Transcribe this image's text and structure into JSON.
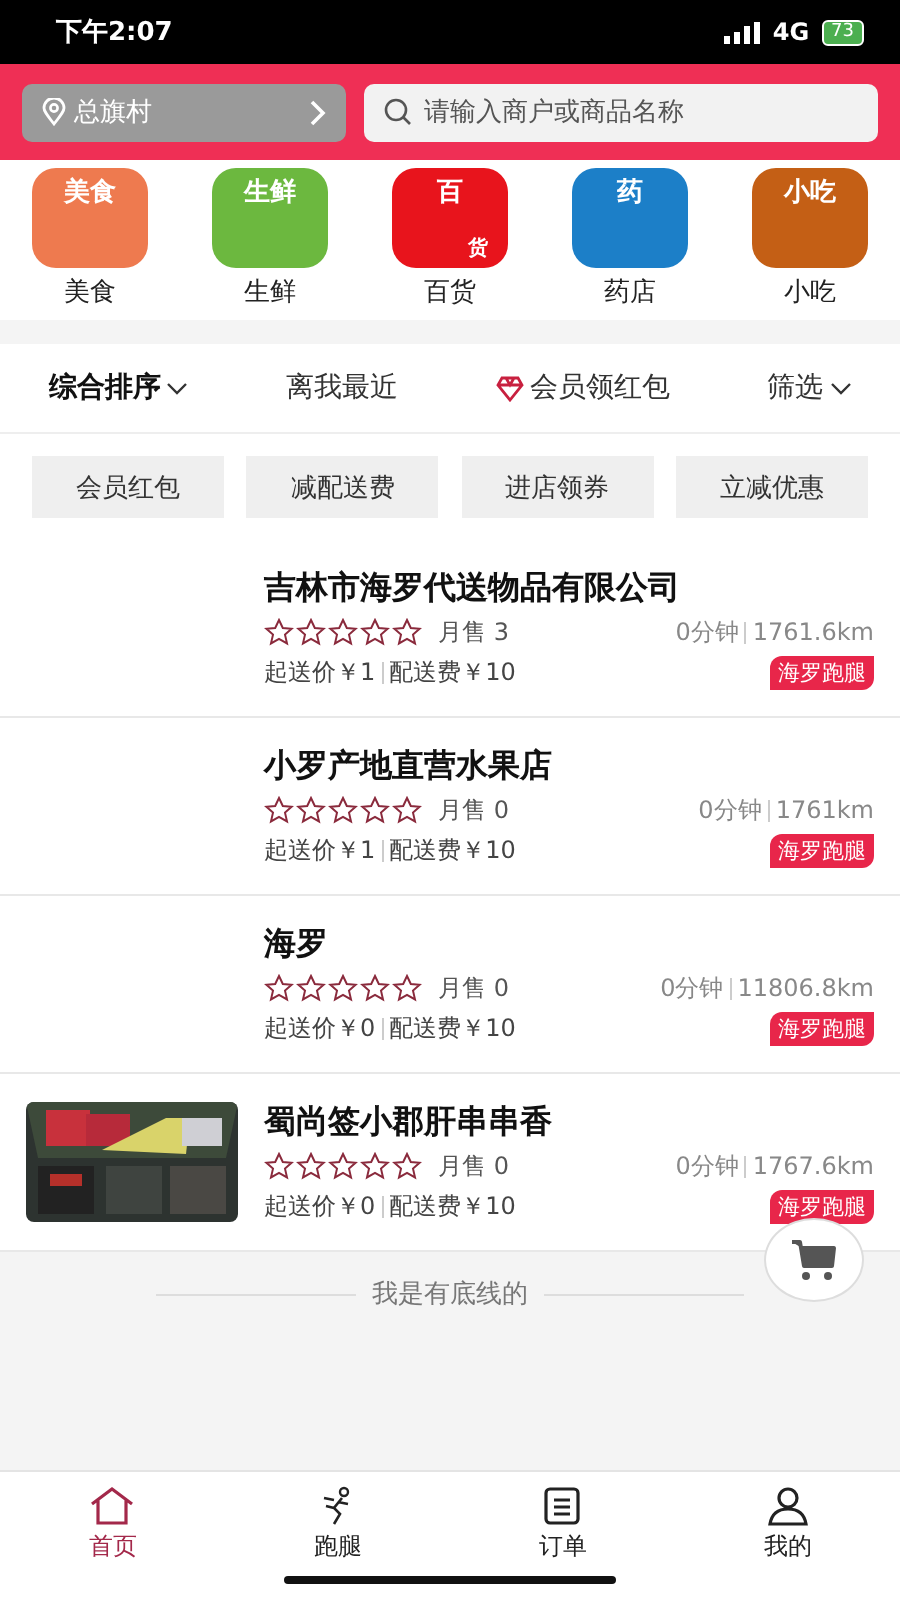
{
  "status_bar": {
    "time": "下午2:07",
    "network": "4G",
    "battery": "73"
  },
  "header": {
    "location": "总旗村",
    "search": {
      "placeholder": "请输入商户或商品名称"
    }
  },
  "categories": [
    {
      "label": "美食",
      "icon_text": [
        "美食"
      ],
      "color": "#ee7a4f"
    },
    {
      "label": "生鲜",
      "icon_text": [
        "生鲜"
      ],
      "color": "#6cb83f"
    },
    {
      "label": "百货",
      "icon_text": [
        "百",
        "货"
      ],
      "color": "#e8141c"
    },
    {
      "label": "药店",
      "icon_text": [
        "药"
      ],
      "color": "#1c7fc8"
    },
    {
      "label": "小吃",
      "icon_text": [
        "小吃"
      ],
      "color": "#c45f15"
    }
  ],
  "sort_options": [
    {
      "label": "综合排序",
      "selected": true,
      "kind": "dropdown"
    },
    {
      "label": "离我最近",
      "selected": false,
      "kind": "plain"
    },
    {
      "label": "会员领红包",
      "selected": false,
      "kind": "gem"
    },
    {
      "label": "筛选",
      "selected": false,
      "kind": "dropdown"
    }
  ],
  "filter_chips": [
    "会员红包",
    "减配送费",
    "进店领券",
    "立减优惠"
  ],
  "shops": [
    {
      "name": "吉林市海罗代送物品有限公司",
      "stars": 0,
      "monthly_sales": "月售 3",
      "time": "0分钟",
      "distance": "1761.6km",
      "min_order": "起送价￥1",
      "delivery_fee": "配送费￥10",
      "tag": "海罗跑腿"
    },
    {
      "name": "小罗产地直营水果店",
      "stars": 0,
      "monthly_sales": "月售 0",
      "time": "0分钟",
      "distance": "1761km",
      "min_order": "起送价￥1",
      "delivery_fee": "配送费￥10",
      "tag": "海罗跑腿"
    },
    {
      "name": "海罗",
      "stars": 0,
      "monthly_sales": "月售 0",
      "time": "0分钟",
      "distance": "11806.8km",
      "min_order": "起送价￥0",
      "delivery_fee": "配送费￥10",
      "tag": "海罗跑腿"
    },
    {
      "name": "蜀尚签小郡肝串串香",
      "stars": 0,
      "monthly_sales": "月售 0",
      "time": "0分钟",
      "distance": "1767.6km",
      "min_order": "起送价￥0",
      "delivery_fee": "配送费￥10",
      "tag": "海罗跑腿",
      "kind": "picture"
    }
  ],
  "end_text": "我是有底线的",
  "tabs": [
    {
      "label": "首页",
      "selected": true
    },
    {
      "label": "跑腿",
      "selected": false
    },
    {
      "label": "订单",
      "selected": false
    },
    {
      "label": "我的",
      "selected": false
    }
  ]
}
